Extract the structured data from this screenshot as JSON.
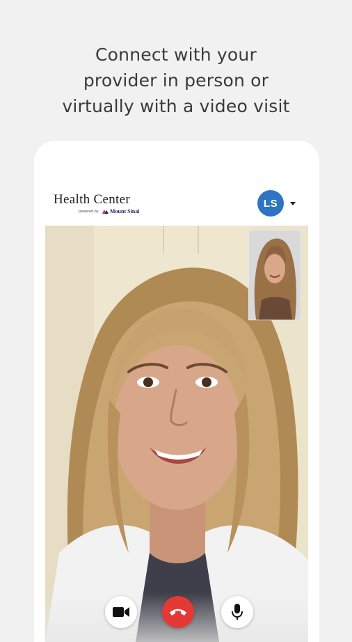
{
  "headline": {
    "line1": "Connect with your",
    "line2": "provider in person or",
    "line3": "virtually with a video visit"
  },
  "app": {
    "title": "Health Center",
    "powered_by": "powered by",
    "brand": "Mount Sinai"
  },
  "user": {
    "initials": "LS",
    "avatar_color": "#2e74c3"
  },
  "call": {
    "controls": [
      {
        "name": "video",
        "icon": "video-camera-icon"
      },
      {
        "name": "hangup",
        "icon": "phone-hangup-icon",
        "color": "#e53935"
      },
      {
        "name": "mic",
        "icon": "microphone-icon"
      }
    ]
  }
}
